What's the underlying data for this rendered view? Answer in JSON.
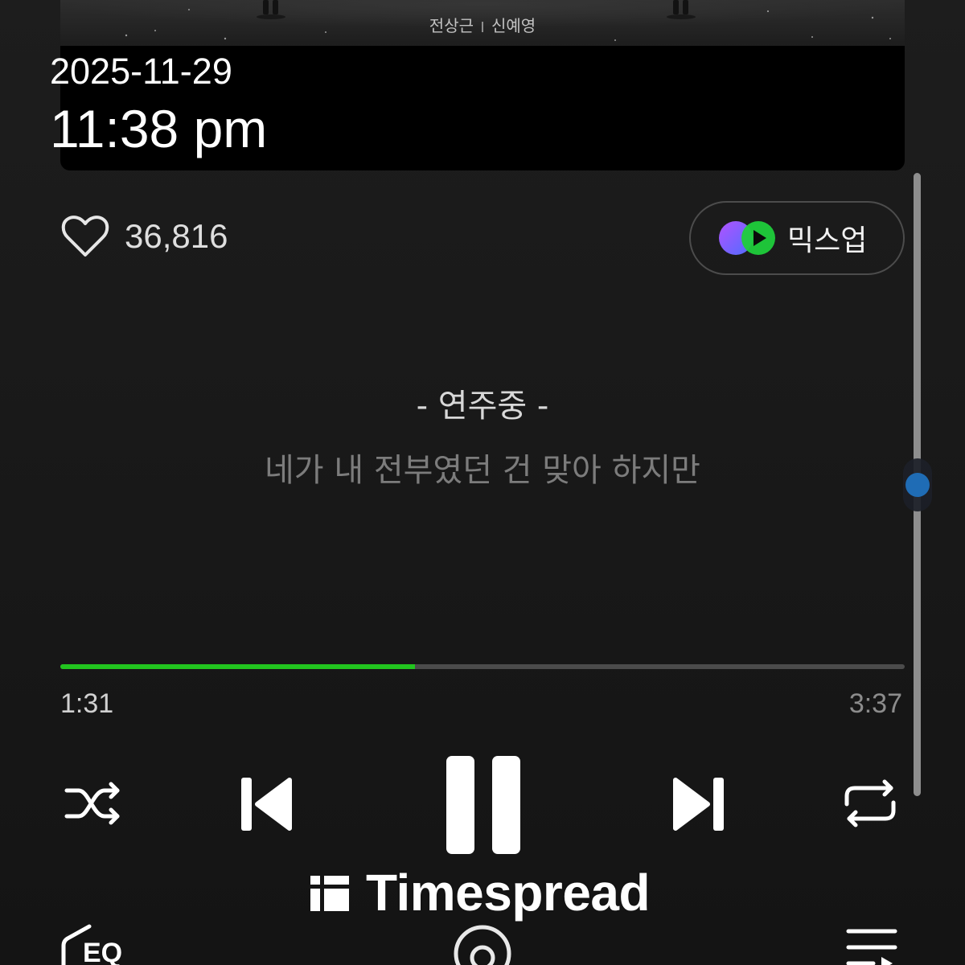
{
  "album": {
    "artists": [
      "전상근",
      "신예영"
    ]
  },
  "overlay": {
    "date": "2025-11-29",
    "time": "11:38 pm"
  },
  "song": {
    "like_count": "36,816",
    "mixup_label": "믹스업"
  },
  "lyrics": {
    "status": "- 연주중 -",
    "next_line": "네가 내 전부였던 건 맞아 하지만",
    "scroll_level": 0.5
  },
  "playback": {
    "elapsed": "1:31",
    "duration": "3:37",
    "progress": 0.42,
    "state": "playing"
  },
  "bottom_bar": {
    "eq_label": "EQ"
  },
  "watermark": {
    "text": "Timespread"
  },
  "icons": {
    "like": "heart-icon",
    "mixup": "mixup-icon",
    "shuffle": "shuffle-icon",
    "previous": "previous-icon",
    "pause": "pause-icon",
    "next": "next-icon",
    "repeat": "repeat-icon",
    "eq": "eq-icon",
    "connect": "connect-icon",
    "playlist": "playlist-icon",
    "watermark_logo": "timespread-logo-icon"
  },
  "colors": {
    "bg_top": "#1d1d1d",
    "bg_bottom": "#141414",
    "accent": "#22c51f",
    "track": "#4b4b4b",
    "scrollbar": "#8e8e8e",
    "scroll_thumb": "#1f6cb5",
    "lyrics_dim": "#7c7c7c"
  }
}
